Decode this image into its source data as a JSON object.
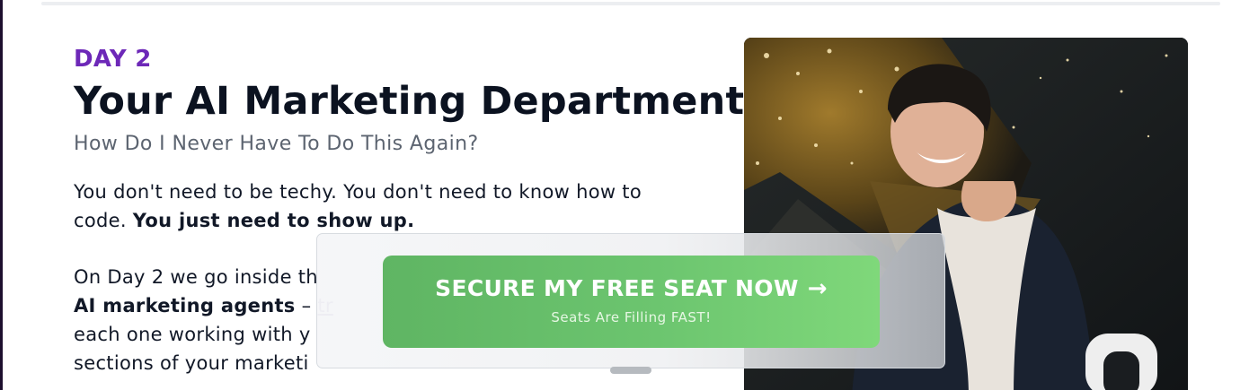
{
  "section": {
    "eyebrow": "DAY 2",
    "title": "Your AI Marketing Department",
    "subtitle": "How Do I Never Have To Do This Again?"
  },
  "para1": {
    "text": "You don't need to be techy. You don't need to know how to code. ",
    "bold": "You just need to show up."
  },
  "para2": {
    "line1": "On Day 2 we go inside th",
    "bold": "AI marketing agents",
    "dash": " – ",
    "link": "tr",
    "line3": "each one working with y",
    "line4": "sections of your marketi"
  },
  "cta": {
    "label": "SECURE MY FREE SEAT NOW",
    "arrow": "→",
    "sublabel": "Seats Are Filling FAST!"
  },
  "colors": {
    "eyebrow": "#6d28b8",
    "cta_green": "#6cc56f",
    "title": "#0b1220"
  }
}
